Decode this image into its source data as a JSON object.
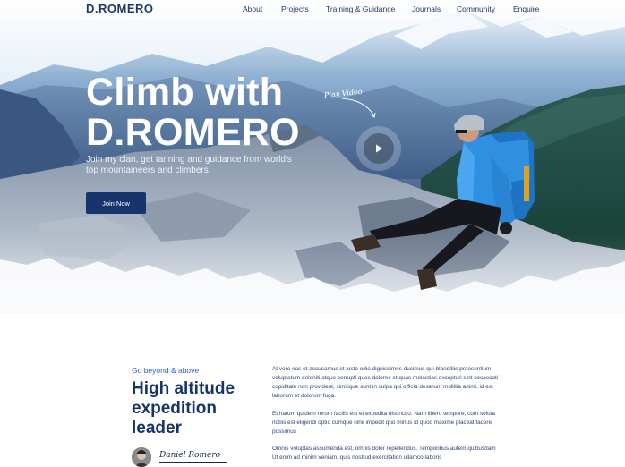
{
  "brand": {
    "logo": "D.ROMERO"
  },
  "nav": {
    "items": [
      "About",
      "Projects",
      "Training & Guidance",
      "Journals",
      "Community",
      "Enquire"
    ]
  },
  "hero": {
    "headline_line1": "Climb with",
    "headline_line2": "D.ROMERO",
    "subtitle": "Join my clan, get tarining and guidance from world's top mountaineers and climbers.",
    "cta_label": "Join Now",
    "play_label": "Play Video",
    "play_icon": "play-icon"
  },
  "about": {
    "eyebrow": "Go beyond & above",
    "title_lines": [
      "High altitude",
      "expedition",
      "leader"
    ],
    "signature_name": "Daniel Romero",
    "paragraphs": [
      "At vero eos et accusamus et iusto odio dignissimos ducimus qui blanditiis praesentium voluptatum deleniti atque corrupti quos dolores et quas molestias excepturi sint occaecati cupiditate non provident, similique sunt in culpa qui officia deserunt mollitia animi, id est laborum et dolorum fuga.",
      "Et harum quidem rerum facilis est et expedita distinctio. Nam libero tempore, cum soluta nobis est eligendi optio cumque nihil impedit quo minus id quod maxime placeat facere possimus",
      "Omnis voluptas assumenda est, omnis dolor repellendus. Temporibus autem quibusdam Ut enim ad minim veniam, quis nostrud exercitation ullamco laboris"
    ]
  },
  "colors": {
    "brand_navy": "#17356b",
    "accent_blue": "#2c5cd6",
    "jacket_blue": "#2f8fe0"
  }
}
